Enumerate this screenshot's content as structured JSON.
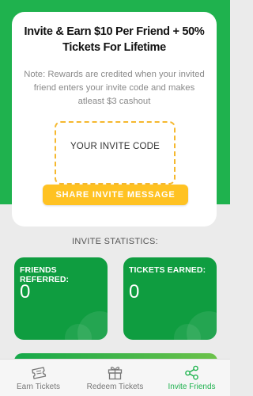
{
  "invite_card": {
    "title": "Invite & Earn $10 Per Friend + 50% Tickets For Lifetime",
    "note": "Note: Rewards are credited when your invited friend enters your invite code and makes atleast $3 cashout",
    "invite_code_placeholder": "YOUR INVITE CODE",
    "share_button": "SHARE INVITE MESSAGE"
  },
  "stats": {
    "heading": "INVITE STATISTICS:",
    "friends_referred": {
      "label": "FRIENDS REFERRED:",
      "value": "0"
    },
    "tickets_earned": {
      "label": "TICKETS EARNED:",
      "value": "0"
    }
  },
  "bottom_nav": {
    "items": [
      {
        "label": "Earn Tickets",
        "icon": "ticket-icon",
        "active": false
      },
      {
        "label": "Redeem Tickets",
        "icon": "gift-icon",
        "active": false
      },
      {
        "label": "Invite Friends",
        "icon": "share-icon",
        "active": true
      }
    ]
  },
  "colors": {
    "brand_green": "#1fb24e",
    "card_green": "#0f9d40",
    "accent_yellow": "#ffc222",
    "dashed_yellow": "#f5b82e"
  }
}
